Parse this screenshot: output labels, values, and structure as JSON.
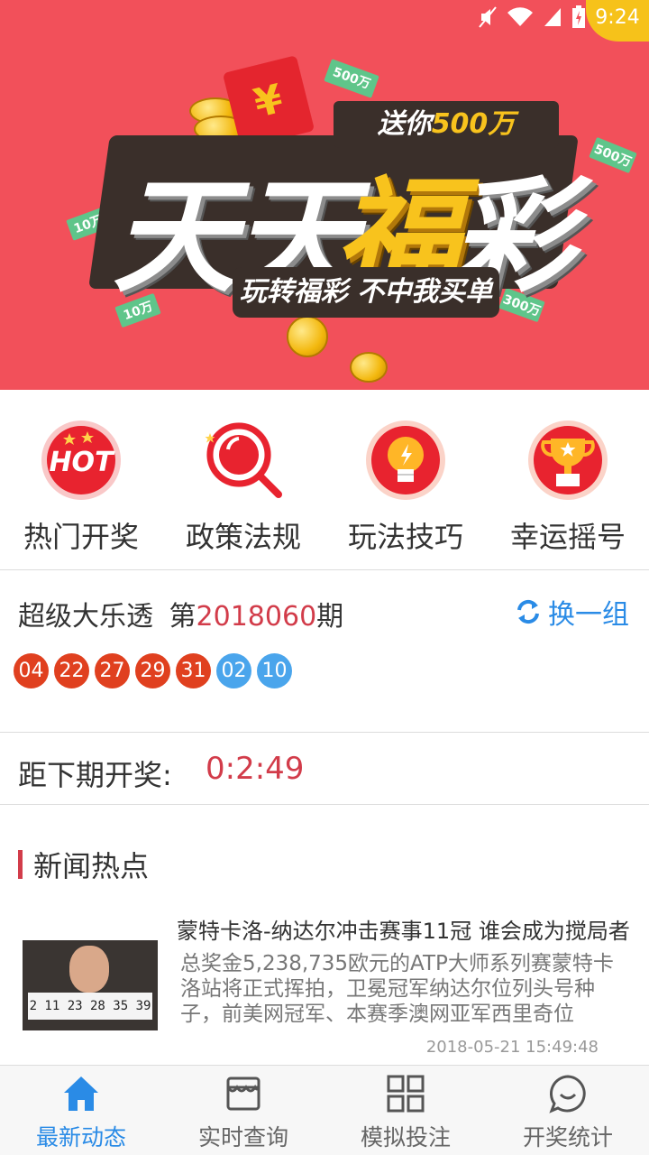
{
  "status_bar": {
    "time": "9:24"
  },
  "banner": {
    "top_tag_prefix": "送你",
    "top_tag_amount": "500万",
    "title_part1": "天天",
    "title_part2": "福",
    "title_part3": "彩",
    "subtitle": "玩转福彩 不中我买单",
    "note_label_500": "500万",
    "note_label_300": "300万",
    "note_label_10": "10万"
  },
  "quick_menu": [
    {
      "label": "热门开奖",
      "icon": "hot-icon"
    },
    {
      "label": "政策法规",
      "icon": "magnifier-icon"
    },
    {
      "label": "玩法技巧",
      "icon": "lightbulb-icon"
    },
    {
      "label": "幸运摇号",
      "icon": "trophy-icon"
    }
  ],
  "hot_icon_text": "HOT",
  "lottery": {
    "name": "超级大乐透",
    "issue_prefix": "第",
    "issue_number": "2018060",
    "issue_suffix": "期",
    "refresh_label": "换一组",
    "red_balls": [
      "04",
      "22",
      "27",
      "29",
      "31"
    ],
    "blue_balls": [
      "02",
      "10"
    ]
  },
  "countdown": {
    "label": "距下期开奖:",
    "value": "0:2:49"
  },
  "news": {
    "heading": "新闻热点",
    "items": [
      {
        "title": "蒙特卡洛-纳达尔冲击赛事11冠 谁会成为搅局者",
        "summary": "总奖金5,238,735欧元的ATP大师系列赛蒙特卡洛站将正式挥拍，卫冕冠军纳达尔位列头号种子，前美网冠军、本赛季澳网亚军西里奇位",
        "date": "2018-05-21 15:49:48",
        "thumb_board_text": "2 11 23 28 35 39"
      }
    ]
  },
  "bottom_nav": [
    {
      "label": "最新动态",
      "icon": "home-icon",
      "active": true
    },
    {
      "label": "实时查询",
      "icon": "store-icon",
      "active": false
    },
    {
      "label": "模拟投注",
      "icon": "grid-icon",
      "active": false
    },
    {
      "label": "开奖统计",
      "icon": "chat-icon",
      "active": false
    }
  ],
  "colors": {
    "accent_blue": "#2a8be6",
    "accent_red": "#d23c4a",
    "banner_red": "#f2505a",
    "red_ball": "#e0401f",
    "blue_ball": "#4aa5ec"
  }
}
